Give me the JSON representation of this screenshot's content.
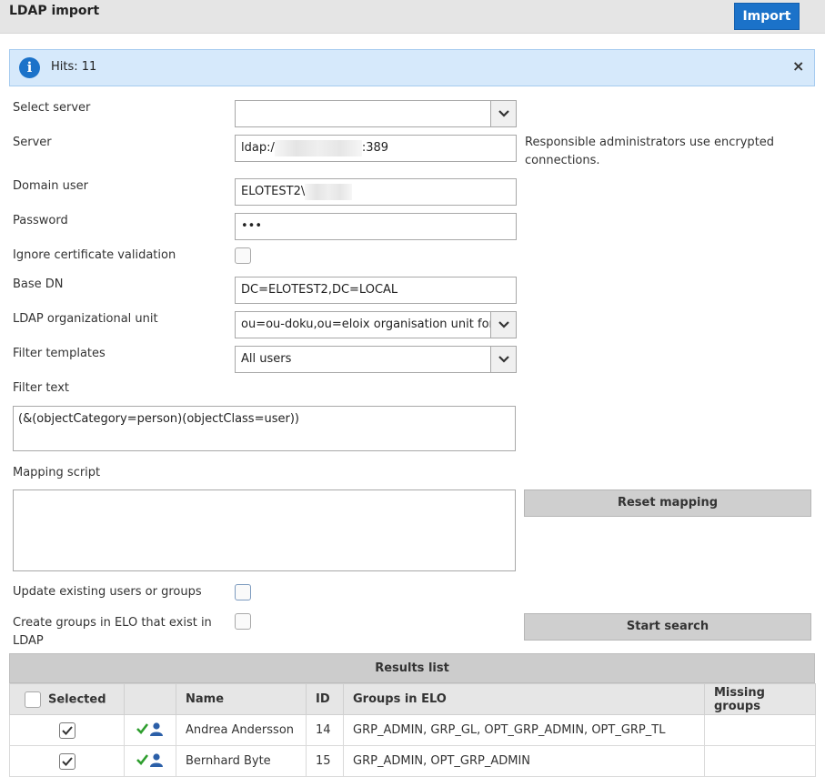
{
  "header": {
    "title": "LDAP import",
    "import_label": "Import"
  },
  "info": {
    "text": "Hits: 11",
    "close": "×"
  },
  "form": {
    "select_server": {
      "label": "Select server",
      "value": ""
    },
    "server": {
      "label": "Server",
      "prefix": "ldap:/",
      "suffix": ":389",
      "hint": "Responsible administrators use encrypted connections."
    },
    "domain_user": {
      "label": "Domain user",
      "value": "ELOTEST2\\"
    },
    "password": {
      "label": "Password",
      "value": "•••"
    },
    "ignore_cert": {
      "label": "Ignore certificate validation",
      "checked": false
    },
    "base_dn": {
      "label": "Base DN",
      "value": "DC=ELOTEST2,DC=LOCAL"
    },
    "org_unit": {
      "label": "LDAP organizational unit",
      "value": "ou=ou-doku,ou=eloix organisation unit for te"
    },
    "filter_templates": {
      "label": "Filter templates",
      "value": "All users"
    },
    "filter_text": {
      "label": "Filter text",
      "value": "(&(objectCategory=person)(objectClass=user))"
    },
    "mapping_script": {
      "label": "Mapping script",
      "value": ""
    },
    "reset_mapping_label": "Reset mapping",
    "update_existing": {
      "label": "Update existing users or groups",
      "checked": false
    },
    "create_groups": {
      "label_line1": "Create groups in ELO that exist in",
      "label_line2": "LDAP",
      "checked": false
    },
    "start_search_label": "Start search"
  },
  "results": {
    "title": "Results list",
    "columns": {
      "selected": "Selected",
      "status": "",
      "name": "Name",
      "id": "ID",
      "groups": "Groups in ELO",
      "missing": "Missing groups"
    },
    "rows": [
      {
        "selected": true,
        "name": "Andrea Andersson",
        "id": "14",
        "groups": "GRP_ADMIN, GRP_GL, OPT_GRP_ADMIN, OPT_GRP_TL",
        "missing": ""
      },
      {
        "selected": true,
        "name": "Bernhard Byte",
        "id": "15",
        "groups": "GRP_ADMIN, OPT_GRP_ADMIN",
        "missing": ""
      }
    ]
  },
  "colors": {
    "accent": "#1b72c9",
    "info_bg": "#d6e9fb",
    "check_green": "#2e9e2e"
  },
  "icons": {
    "info": "info-icon",
    "close": "close-icon",
    "dropdown": "chevron-down-icon",
    "user_ok": "user-check-icon"
  }
}
